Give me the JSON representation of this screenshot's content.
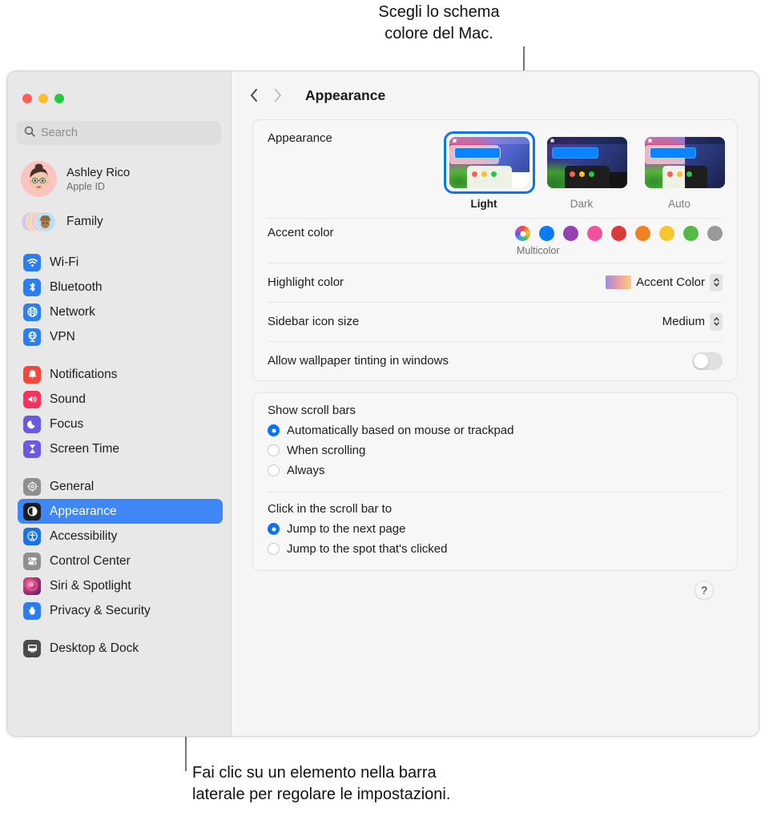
{
  "annotations": {
    "top": "Scegli lo schema\ncolore del Mac.",
    "bottom": "Fai clic su un elemento nella barra\nlaterale per regolare le impostazioni."
  },
  "window": {
    "traffic_lights": [
      "close",
      "minimize",
      "zoom"
    ]
  },
  "sidebar": {
    "search": {
      "placeholder": "Search",
      "value": ""
    },
    "account": {
      "name": "Ashley Rico",
      "subtitle": "Apple ID"
    },
    "family": {
      "label": "Family"
    },
    "groups": [
      {
        "items": [
          {
            "label": "Wi-Fi",
            "icon": "wifi-icon",
            "color": "#2b7ef0"
          },
          {
            "label": "Bluetooth",
            "icon": "bluetooth-icon",
            "color": "#2b7ef0"
          },
          {
            "label": "Network",
            "icon": "globe-icon",
            "color": "#2b7ef0"
          },
          {
            "label": "VPN",
            "icon": "vpn-icon",
            "color": "#2b7ef0"
          }
        ]
      },
      {
        "items": [
          {
            "label": "Notifications",
            "icon": "bell-icon",
            "color": "#f5463b"
          },
          {
            "label": "Sound",
            "icon": "speaker-icon",
            "color": "#f5325b"
          },
          {
            "label": "Focus",
            "icon": "moon-icon",
            "color": "#6a5ae0"
          },
          {
            "label": "Screen Time",
            "icon": "hourglass-icon",
            "color": "#6a5ae0"
          }
        ]
      },
      {
        "items": [
          {
            "label": "General",
            "icon": "gear-icon",
            "color": "#8e8e93",
            "selected": false
          },
          {
            "label": "Appearance",
            "icon": "contrast-icon",
            "color": "#1c1c1c",
            "selected": true
          },
          {
            "label": "Accessibility",
            "icon": "accessibility-icon",
            "color": "#1a73e8",
            "selected": false
          },
          {
            "label": "Control Center",
            "icon": "switches-icon",
            "color": "#8e8e93",
            "selected": false
          },
          {
            "label": "Siri & Spotlight",
            "icon": "siri-icon",
            "color": "#c0326e",
            "selected": false
          },
          {
            "label": "Privacy & Security",
            "icon": "hand-icon",
            "color": "#2b7ef0",
            "selected": false
          }
        ]
      },
      {
        "items": [
          {
            "label": "Desktop & Dock",
            "icon": "desktop-icon",
            "color": "#4a4a4a"
          }
        ]
      }
    ]
  },
  "main": {
    "title": "Appearance",
    "nav": {
      "back": "back",
      "forward": "forward"
    },
    "appearance": {
      "label": "Appearance",
      "options": [
        {
          "name": "Light",
          "selected": true
        },
        {
          "name": "Dark",
          "selected": false
        },
        {
          "name": "Auto",
          "selected": false
        }
      ]
    },
    "accent": {
      "label": "Accent color",
      "selected_name": "Multicolor",
      "colors": [
        {
          "name": "Multicolor",
          "hex": "multi",
          "selected": true
        },
        {
          "name": "Blue",
          "hex": "#0a7cf6",
          "selected": false
        },
        {
          "name": "Purple",
          "hex": "#9341b3",
          "selected": false
        },
        {
          "name": "Pink",
          "hex": "#f2519b",
          "selected": false
        },
        {
          "name": "Red",
          "hex": "#d93b3b",
          "selected": false
        },
        {
          "name": "Orange",
          "hex": "#f08222",
          "selected": false
        },
        {
          "name": "Yellow",
          "hex": "#f7c52e",
          "selected": false
        },
        {
          "name": "Green",
          "hex": "#54ba46",
          "selected": false
        },
        {
          "name": "Graphite",
          "hex": "#999999",
          "selected": false
        }
      ]
    },
    "highlight": {
      "label": "Highlight color",
      "value": "Accent Color"
    },
    "sidebar_icon_size": {
      "label": "Sidebar icon size",
      "value": "Medium"
    },
    "wallpaper_tinting": {
      "label": "Allow wallpaper tinting in windows",
      "enabled": false
    },
    "scroll_bars": {
      "label": "Show scroll bars",
      "options": [
        {
          "label": "Automatically based on mouse or trackpad",
          "selected": true
        },
        {
          "label": "When scrolling",
          "selected": false
        },
        {
          "label": "Always",
          "selected": false
        }
      ]
    },
    "scroll_click": {
      "label": "Click in the scroll bar to",
      "options": [
        {
          "label": "Jump to the next page",
          "selected": true
        },
        {
          "label": "Jump to the spot that's clicked",
          "selected": false
        }
      ]
    },
    "help": {
      "label": "?"
    }
  }
}
